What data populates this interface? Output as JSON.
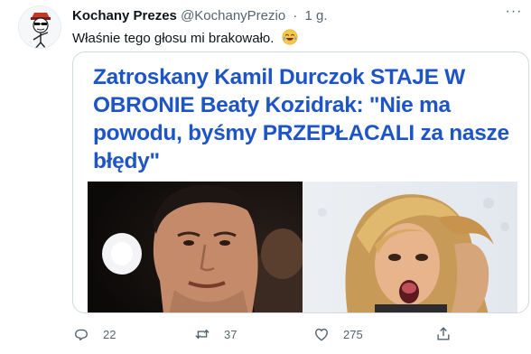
{
  "tweet": {
    "author_name": "Kochany Prezes",
    "author_handle": "@KochanyPrezio",
    "separator": "·",
    "time": "1 g.",
    "more_label": "···",
    "text": "Właśnie tego głosu mi brakowało.",
    "emoji": "face-with-tears-of-joy"
  },
  "card": {
    "headline": "Zatroskany Kamil Durczok STAJE W OBRONIE Beaty Kozidrak: \"Nie ma powodu, byśmy PRZEPŁACALI za nasze błędy\""
  },
  "actions": {
    "replies": "22",
    "retweets": "37",
    "likes": "275"
  },
  "colors": {
    "headline": "#1d55c6",
    "muted": "#536471",
    "border": "#cfd9de"
  }
}
